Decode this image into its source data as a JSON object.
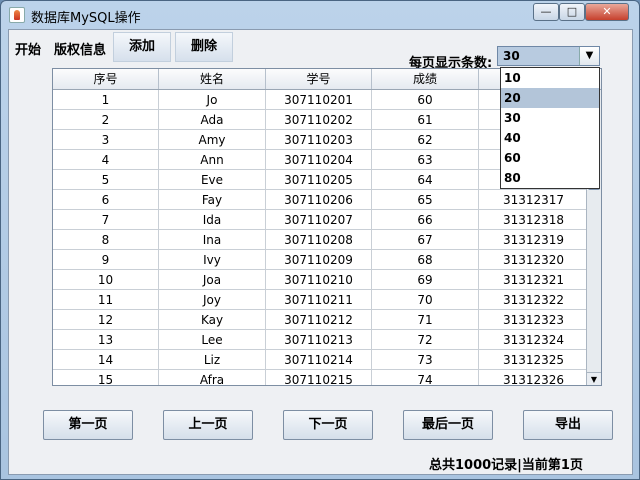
{
  "window": {
    "title": "数据库MySQL操作",
    "min": "—",
    "max": "□",
    "close": "✕"
  },
  "menu": {
    "start": "开始",
    "copyright": "版权信息",
    "add": "添加",
    "delete": "删除"
  },
  "pagesize": {
    "label": "每页显示条数:",
    "value": "30",
    "options": [
      "10",
      "20",
      "30",
      "40",
      "60",
      "80"
    ],
    "highlighted": "20"
  },
  "table": {
    "headers": [
      "序号",
      "姓名",
      "学号",
      "成绩",
      ""
    ],
    "rows": [
      [
        "1",
        "Jo",
        "307110201",
        "60",
        ""
      ],
      [
        "2",
        "Ada",
        "307110202",
        "61",
        ""
      ],
      [
        "3",
        "Amy",
        "307110203",
        "62",
        ""
      ],
      [
        "4",
        "Ann",
        "307110204",
        "63",
        ""
      ],
      [
        "5",
        "Eve",
        "307110205",
        "64",
        ""
      ],
      [
        "6",
        "Fay",
        "307110206",
        "65",
        "31312317"
      ],
      [
        "7",
        "Ida",
        "307110207",
        "66",
        "31312318"
      ],
      [
        "8",
        "Ina",
        "307110208",
        "67",
        "31312319"
      ],
      [
        "9",
        "Ivy",
        "307110209",
        "68",
        "31312320"
      ],
      [
        "10",
        "Joa",
        "307110210",
        "69",
        "31312321"
      ],
      [
        "11",
        "Joy",
        "307110211",
        "70",
        "31312322"
      ],
      [
        "12",
        "Kay",
        "307110212",
        "71",
        "31312323"
      ],
      [
        "13",
        "Lee",
        "307110213",
        "72",
        "31312324"
      ],
      [
        "14",
        "Liz",
        "307110214",
        "73",
        "31312325"
      ],
      [
        "15",
        "Afra",
        "307110215",
        "74",
        "31312326"
      ]
    ]
  },
  "pager": {
    "first": "第一页",
    "prev": "上一页",
    "next": "下一页",
    "last": "最后一页",
    "export": "导出"
  },
  "status": "总共1000记录|当前第1页",
  "icons": {
    "combo_arrow": "chevron-down-icon",
    "scroll_down": "arrow-down-icon"
  }
}
